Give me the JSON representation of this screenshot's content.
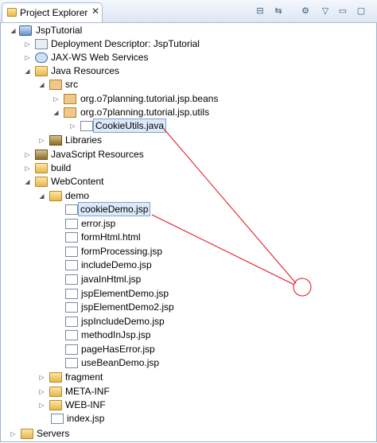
{
  "view": {
    "tab_title": "Project Explorer",
    "tab_close": "✕",
    "toolbar": [
      {
        "name": "collapse-all-icon",
        "glyph": "⊟"
      },
      {
        "name": "link-with-editor-icon",
        "glyph": "⇆"
      },
      {
        "name": "filters-icon",
        "glyph": "⚙"
      },
      {
        "name": "view-menu-icon",
        "glyph": "▽"
      },
      {
        "name": "minimize-icon",
        "glyph": "▭"
      },
      {
        "name": "maximize-icon",
        "glyph": "▢"
      }
    ]
  },
  "tree": {
    "project": "JspTutorial",
    "deployment_descriptor": "Deployment Descriptor: JspTutorial",
    "jaxws": "JAX-WS Web Services",
    "java_resources": "Java Resources",
    "src": "src",
    "pkg_beans": "org.o7planning.tutorial.jsp.beans",
    "pkg_utils": "org.o7planning.tutorial.jsp.utils",
    "cookie_utils": "CookieUtils.java",
    "libraries": "Libraries",
    "js_resources": "JavaScript Resources",
    "build": "build",
    "webcontent": "WebContent",
    "demo": "demo",
    "demo_files": [
      "cookieDemo.jsp",
      "error.jsp",
      "formHtml.html",
      "formProcessing.jsp",
      "includeDemo.jsp",
      "javaInHtml.jsp",
      "jspElementDemo.jsp",
      "jspElementDemo2.jsp",
      "jspIncludeDemo.jsp",
      "methodInJsp.jsp",
      "pageHasError.jsp",
      "useBeanDemo.jsp"
    ],
    "fragment": "fragment",
    "meta_inf": "META-INF",
    "web_inf": "WEB-INF",
    "index": "index.jsp",
    "servers": "Servers"
  },
  "colors": {
    "selection_bg": "#dce9f8",
    "selection_border": "#7da2ce",
    "annotation": "#e0101a"
  }
}
